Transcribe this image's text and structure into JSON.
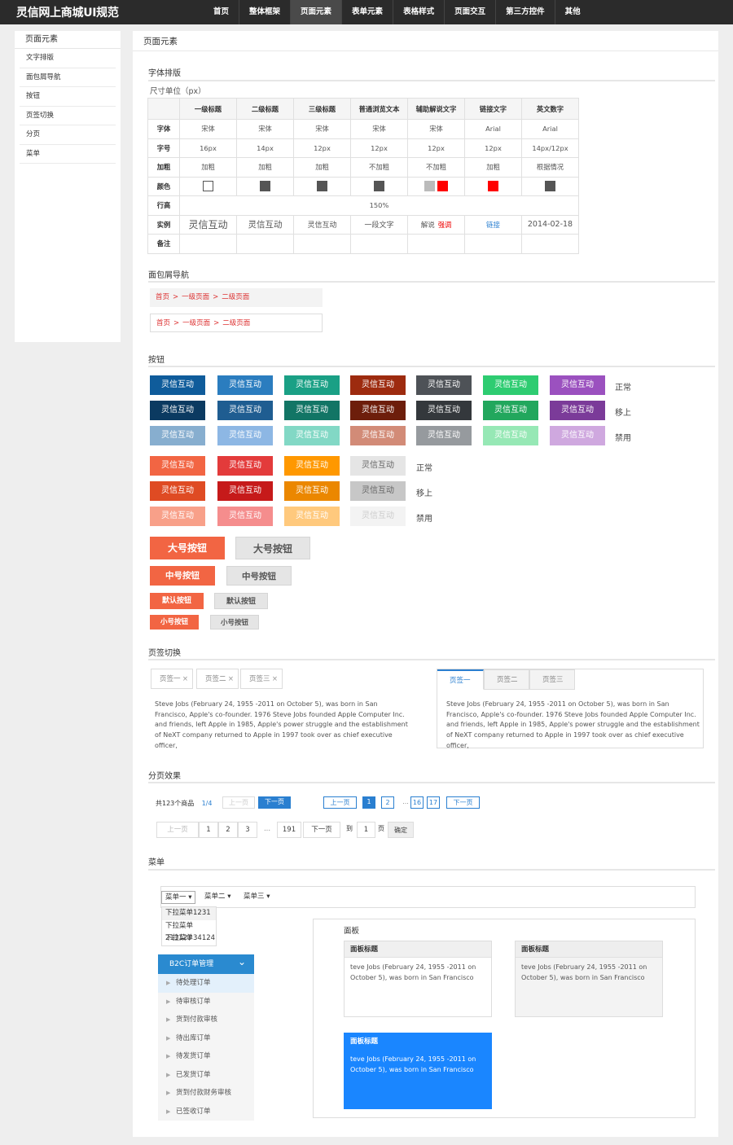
{
  "header": {
    "logo": "灵信网上商城UI规范",
    "nav": [
      "首页",
      "整体框架",
      "页面元素",
      "表单元素",
      "表格样式",
      "页面交互",
      "第三方控件",
      "其他"
    ],
    "active_nav": "页面元素"
  },
  "sidebar": {
    "title": "页面元素",
    "items": [
      "文字排版",
      "面包屑导航",
      "按钮",
      "页签切换",
      "分页",
      "菜单"
    ]
  },
  "main": {
    "title": "页面元素"
  },
  "typography": {
    "section_title": "字体排版",
    "unit_label": "尺寸单位（px）",
    "columns": [
      "一级标题",
      "二级标题",
      "三级标题",
      "普通浏览文本",
      "辅助解说文字",
      "链接文字",
      "英文数字"
    ],
    "rows": {
      "font": {
        "label": "字体",
        "values": [
          "宋体",
          "宋体",
          "宋体",
          "宋体",
          "宋体",
          "Arial",
          "Arial"
        ]
      },
      "size": {
        "label": "字号",
        "values": [
          "16px",
          "14px",
          "12px",
          "12px",
          "12px",
          "12px",
          "14px/12px"
        ]
      },
      "weight": {
        "label": "加粗",
        "values": [
          "加粗",
          "加粗",
          "加粗",
          "不加粗",
          "不加粗",
          "加粗",
          "根据情况"
        ]
      },
      "color": {
        "label": "颜色",
        "swatches": [
          [
            "#ffffff"
          ],
          [
            "#555555"
          ],
          [
            "#555555"
          ],
          [
            "#555555"
          ],
          [
            "#bbbbbb",
            "#ff0000"
          ],
          [
            "#ff0000"
          ],
          [
            "#555555"
          ]
        ]
      },
      "line_height": {
        "label": "行高",
        "value": "150%"
      },
      "example": {
        "label": "实例",
        "values": [
          "灵信互动",
          "灵信互动",
          "灵信互动",
          "一段文字",
          "解说",
          "链接",
          "2014-02-18"
        ],
        "emphasis": "强调"
      },
      "note": {
        "label": "备注"
      }
    }
  },
  "breadcrumb": {
    "section_title": "面包屑导航",
    "items": [
      "首页",
      "一级页面",
      "二级页面"
    ],
    "separator": ">"
  },
  "buttons": {
    "section_title": "按钮",
    "label": "灵信互动",
    "states_a": [
      "正常",
      "移上",
      "禁用"
    ],
    "states_b": [
      "正常",
      "移上",
      "禁用"
    ],
    "palette_a": [
      [
        "#0f5c9b",
        "#2b7dbf",
        "#1aa085",
        "#9d2b0f",
        "#4e5257",
        "#2ecc71",
        "#9b51bf"
      ],
      [
        "#0b3a61",
        "#1f5d91",
        "#127565",
        "#6d1e0b",
        "#34383c",
        "#22a75d",
        "#7b3b99"
      ],
      [
        "#87aecf",
        "#8db7e4",
        "#82d8c5",
        "#d28b77",
        "#969a9e",
        "#96e8b5",
        "#cfa8df"
      ]
    ],
    "palette_b": [
      [
        "#f26543",
        "#e33b3b",
        "#ff9800",
        "#e5e5e5"
      ],
      [
        "#df4b23",
        "#c61a1a",
        "#eb8700",
        "#c7c7c7"
      ],
      [
        "#f8a089",
        "#f58d8d",
        "#ffc97d",
        "#f3f3f3"
      ]
    ],
    "sizes": [
      {
        "primary": "大号按钮",
        "secondary": "大号按钮"
      },
      {
        "primary": "中号按钮",
        "secondary": "中号按钮"
      },
      {
        "primary": "默认按钮",
        "secondary": "默认按钮"
      },
      {
        "primary": "小号按钮",
        "secondary": "小号按钮"
      }
    ]
  },
  "tabs": {
    "section_title": "页签切换",
    "labels": [
      "页签一",
      "页签二",
      "页签三"
    ],
    "close": "×",
    "body": "Steve Jobs (February 24, 1955 -2011 on October 5), was born in San Francisco, Apple's co-founder. 1976 Steve Jobs founded Apple Computer Inc. and friends, left Apple in 1985, Apple's power struggle and the establishment of NeXT company returned to Apple in 1997 took over as chief executive officer,"
  },
  "pagination": {
    "section_title": "分页效果",
    "total": "共123个商品",
    "fraction": "1/4",
    "prev": "上一页",
    "next": "下一页",
    "simple_pages": [
      "1",
      "2",
      "...",
      "16",
      "17"
    ],
    "full_pages": [
      "1",
      "2",
      "3",
      "...",
      "191"
    ],
    "goto_label": "到",
    "goto_value": "1",
    "page_label": "页",
    "confirm": "确定"
  },
  "menu": {
    "section_title": "菜单",
    "items": [
      "菜单一",
      "菜单二",
      "菜单三"
    ],
    "dropdown": [
      "下拉菜单1231",
      "下拉菜单213123",
      "下拉菜单34124"
    ],
    "accordion_title": "B2C订单管理",
    "accordion_items": [
      "待处理订单",
      "待审核订单",
      "货到付款审核",
      "待出库订单",
      "待发货订单",
      "已发货订单",
      "货到付款财务审核",
      "已签收订单"
    ],
    "panel_label": "面板",
    "panel_title": "面板标题",
    "panel_body": "teve Jobs (February 24, 1955 -2011 on October 5), was born in San Francisco"
  }
}
